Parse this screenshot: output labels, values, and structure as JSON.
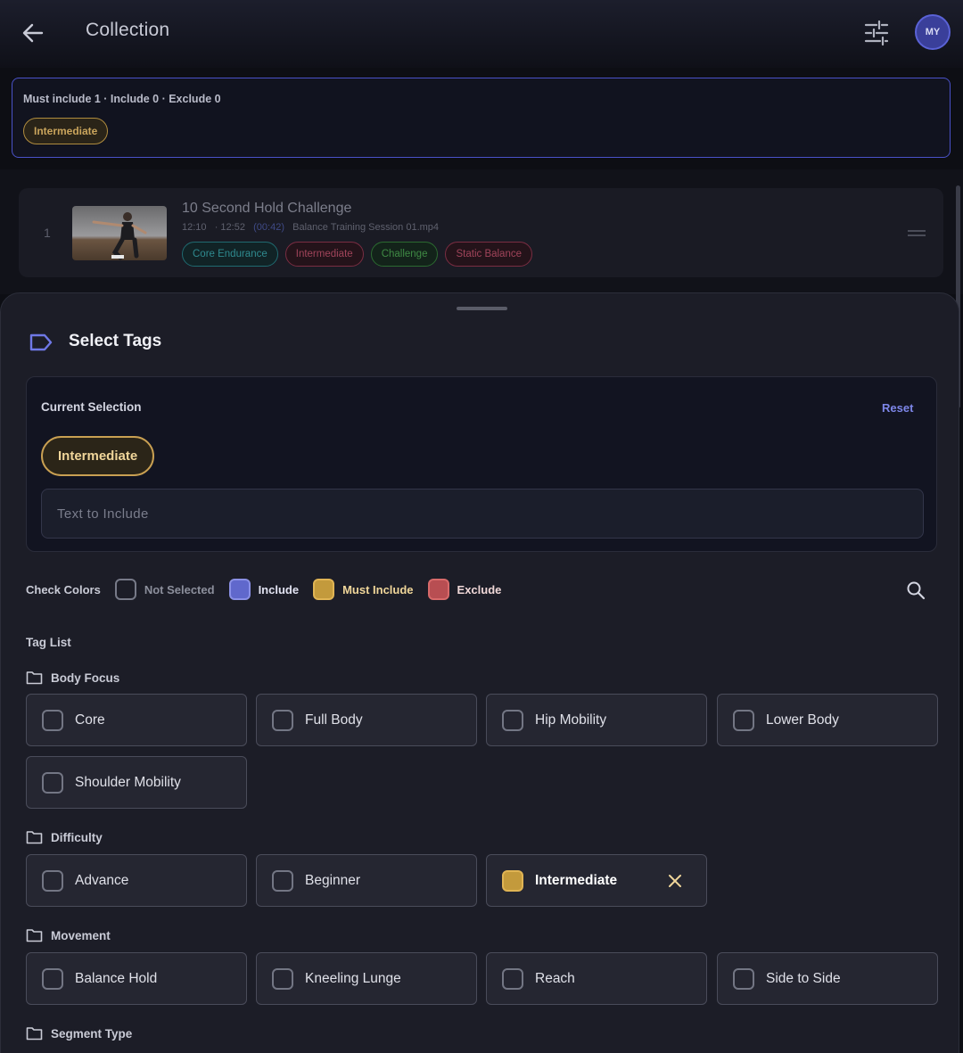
{
  "appbar": {
    "title": "Collection",
    "avatar": "MY"
  },
  "summary": {
    "text": "Must include 1 · Include 0 · Exclude 0",
    "chip": "Intermediate"
  },
  "item": {
    "index": "1",
    "title": "10 Second Hold Challenge",
    "start": "12:10",
    "end": "· 12:52",
    "duration": "(00:42)",
    "file": "Balance Training Session 01.mp4",
    "tags": [
      "Core Endurance",
      "Intermediate",
      "Challenge",
      "Static Balance"
    ]
  },
  "sheet": {
    "title": "Select Tags",
    "current_label": "Current Selection",
    "reset": "Reset",
    "selected_chip": "Intermediate",
    "text_placeholder": "Text to Include"
  },
  "legend": {
    "label": "Check Colors",
    "not_selected": "Not Selected",
    "include": "Include",
    "must_include": "Must Include",
    "exclude": "Exclude"
  },
  "tag_list_label": "Tag List",
  "groups": {
    "body_focus": {
      "name": "Body Focus",
      "tags": [
        "Core",
        "Full Body",
        "Hip Mobility",
        "Lower Body",
        "Shoulder Mobility"
      ]
    },
    "difficulty": {
      "name": "Difficulty",
      "tags": [
        "Advance",
        "Beginner",
        "Intermediate"
      ]
    },
    "movement": {
      "name": "Movement",
      "tags": [
        "Balance Hold",
        "Kneeling Lunge",
        "Reach",
        "Side to Side"
      ]
    },
    "segment_type": {
      "name": "Segment Type"
    }
  },
  "colors": {
    "include": "#6068cc",
    "must_include": "#c39a3c",
    "exclude": "#b84e52",
    "accent": "#7d86e8"
  }
}
